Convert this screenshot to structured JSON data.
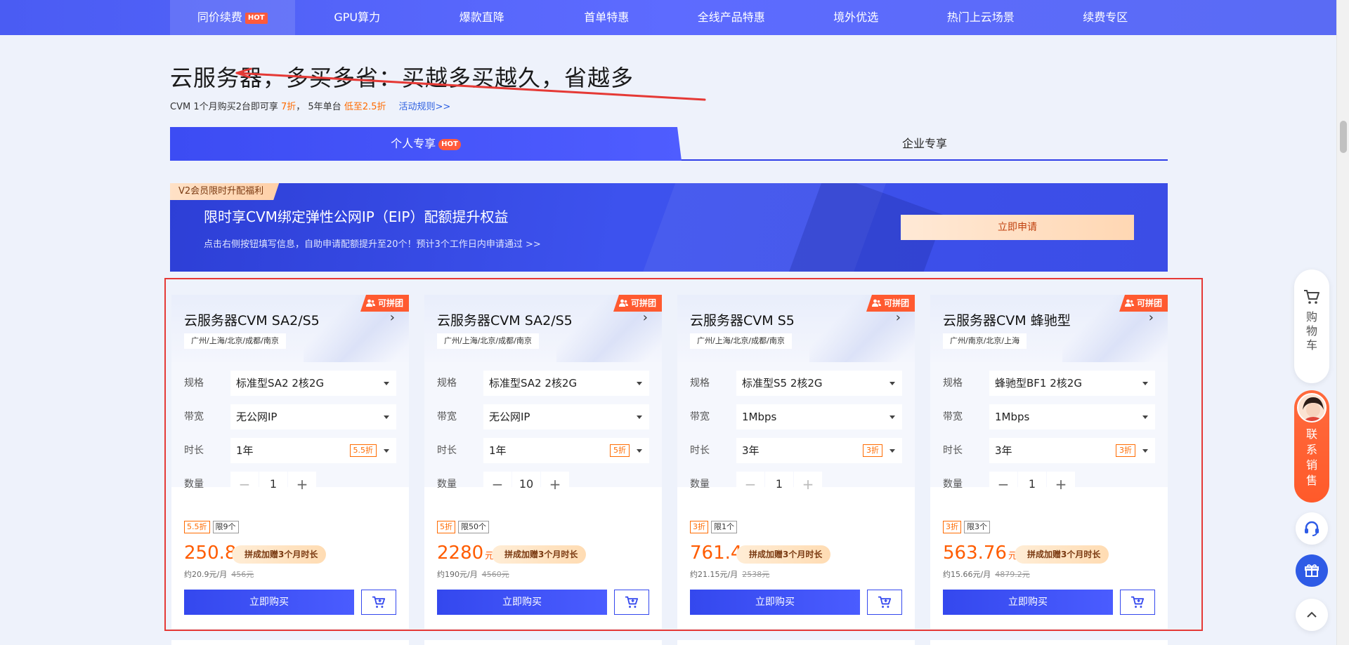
{
  "nav": {
    "items": [
      {
        "label": "同价续费",
        "badge": "HOT"
      },
      {
        "label": "GPU算力"
      },
      {
        "label": "爆款直降"
      },
      {
        "label": "首单特惠"
      },
      {
        "label": "全线产品特惠"
      },
      {
        "label": "境外优选"
      },
      {
        "label": "热门上云场景"
      },
      {
        "label": "续费专区"
      }
    ]
  },
  "heading": {
    "title": "云服务器，多买多省：买越多买越久，省越多",
    "sub_prefix": "CVM 1个月购买2台即可享 ",
    "sub_discount1": "7折",
    "sub_mid": "， 5年单台 ",
    "sub_discount2": "低至2.5折",
    "rules_link": "活动规则>>"
  },
  "tabs": {
    "personal": "个人专享",
    "personal_badge": "HOT",
    "enterprise": "企业专享"
  },
  "banner": {
    "ribbon": "V2会员限时升配福利",
    "title": "限时享CVM绑定弹性公网IP（EIP）配额提升权益",
    "desc": "点击右侧按钮填写信息，自助申请配额提升至20个！预计3个工作日内申请通过 >>",
    "button": "立即申请"
  },
  "labels": {
    "spec": "规格",
    "bandwidth": "带宽",
    "duration": "时长",
    "quantity": "数量",
    "group_badge": "可拼团",
    "promo": "拼成加赠3个月时长",
    "buy": "立即购买",
    "unit": "元"
  },
  "cards": [
    {
      "title": "云服务器CVM SA2/S5",
      "regions": "广州/上海/北京/成都/南京",
      "spec": "标准型SA2 2核2G",
      "bandwidth": "无公网IP",
      "duration": "1年",
      "duration_discount": "5.5折",
      "quantity": "1",
      "tag_discount": "5.5折",
      "tag_limit": "限9个",
      "price": "250.8",
      "per_month": "约20.9元/月",
      "original": "456元"
    },
    {
      "title": "云服务器CVM SA2/S5",
      "regions": "广州/上海/北京/成都/南京",
      "spec": "标准型SA2 2核2G",
      "bandwidth": "无公网IP",
      "duration": "1年",
      "duration_discount": "5折",
      "quantity": "10",
      "tag_discount": "5折",
      "tag_limit": "限50个",
      "price": "2280",
      "per_month": "约190元/月",
      "original": "4560元"
    },
    {
      "title": "云服务器CVM S5",
      "regions": "广州/上海/北京/成都/南京",
      "spec": "标准型S5 2核2G",
      "bandwidth": "1Mbps",
      "duration": "3年",
      "duration_discount": "3折",
      "quantity": "1",
      "tag_discount": "3折",
      "tag_limit": "限1个",
      "price": "761.4",
      "per_month": "约21.15元/月",
      "original": "2538元"
    },
    {
      "title": "云服务器CVM 蜂驰型",
      "regions": "广州/南京/北京/上海",
      "spec": "蜂驰型BF1 2核2G",
      "bandwidth": "1Mbps",
      "duration": "3年",
      "duration_discount": "3折",
      "quantity": "1",
      "tag_discount": "3折",
      "tag_limit": "限3个",
      "price": "563.76",
      "per_month": "约15.66元/月",
      "original": "4879.2元"
    }
  ],
  "sidebar": {
    "cart_label": "购物车",
    "sales_label": "联系销售"
  },
  "colors": {
    "brand": "#3448ee",
    "accent_orange": "#ff5c00",
    "annotation_red": "#e53935"
  }
}
